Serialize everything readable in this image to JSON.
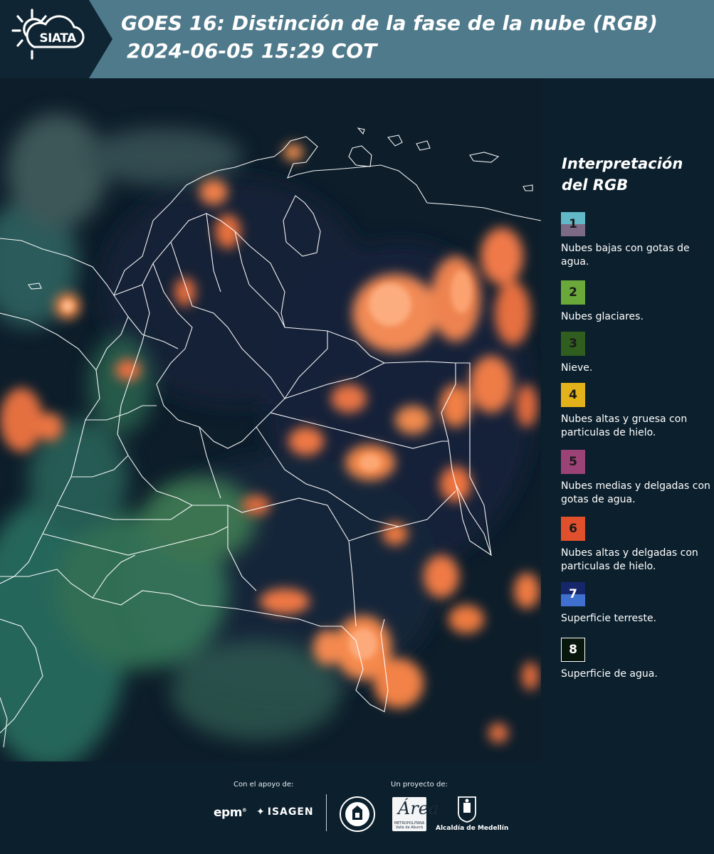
{
  "header": {
    "logo_text": "SIATA",
    "title_line1": "GOES 16: Distinción de la fase de la nube (RGB)",
    "title_line2": "2024-06-05 15:29 COT"
  },
  "legend": {
    "title_line1": "Interpretación",
    "title_line2": "del RGB",
    "items": [
      {
        "number": "1",
        "label": "Nubes bajas con gotas de agua.",
        "color_top": "#63b8c7",
        "color_bottom": "#7d6a86"
      },
      {
        "number": "2",
        "label": "Nubes glaciares.",
        "color": "#6aa83a"
      },
      {
        "number": "3",
        "label": "Nieve.",
        "color": "#2f5e1f"
      },
      {
        "number": "4",
        "label": "Nubes altas y gruesa con particulas de hielo.",
        "color": "#e3b21a"
      },
      {
        "number": "5",
        "label": "Nubes medias y delgadas con gotas de agua.",
        "color": "#9b4277"
      },
      {
        "number": "6",
        "label": "Nubes altas y delgadas con particulas de hielo.",
        "color": "#e0502c"
      },
      {
        "number": "7",
        "label": "Superficie terreste.",
        "color_top": "#16266a",
        "color_bottom": "#3f6fcf"
      },
      {
        "number": "8",
        "label": "Superficie de agua.",
        "color": "#07170c"
      }
    ]
  },
  "footer": {
    "support_caption": "Con el apoyo de:",
    "project_caption": "Un proyecto de:",
    "epm_logo": "epm",
    "isagen_logo": "ISAGEN",
    "amva_logo_letter": "Área",
    "amva_logo_text": "METROPOLITANA Valle de Aburrá",
    "medellin_logo": "Alcaldía de Medellín"
  }
}
